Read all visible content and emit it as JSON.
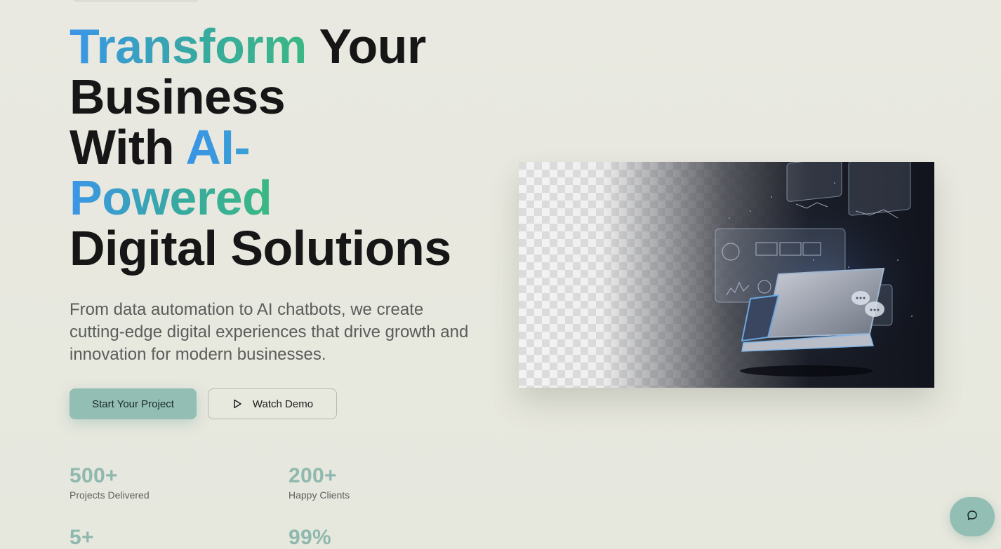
{
  "hero": {
    "headline": {
      "word_transform": "Transform",
      "word_your": " Your",
      "word_business": "Business",
      "word_with": "With ",
      "word_ai": "AI-",
      "word_powered": "Powered",
      "word_digital_solutions": "Digital Solutions"
    },
    "subtitle": "From data automation to AI chatbots, we create cutting-edge digital experiences that drive growth and innovation for modern businesses.",
    "primary_cta": "Start Your Project",
    "secondary_cta": "Watch Demo"
  },
  "stats": [
    {
      "value": "500+",
      "label": "Projects Delivered"
    },
    {
      "value": "200+",
      "label": "Happy Clients"
    },
    {
      "value": "5+",
      "label": ""
    },
    {
      "value": "99%",
      "label": ""
    }
  ],
  "icons": {
    "play": "play-icon",
    "chat": "chat-bubble-icon"
  },
  "colors": {
    "accent": "#93beb4",
    "gradient_start": "#3b95e8",
    "gradient_end": "#3bb884",
    "background": "#e8e8e0",
    "text_primary": "#161616"
  }
}
